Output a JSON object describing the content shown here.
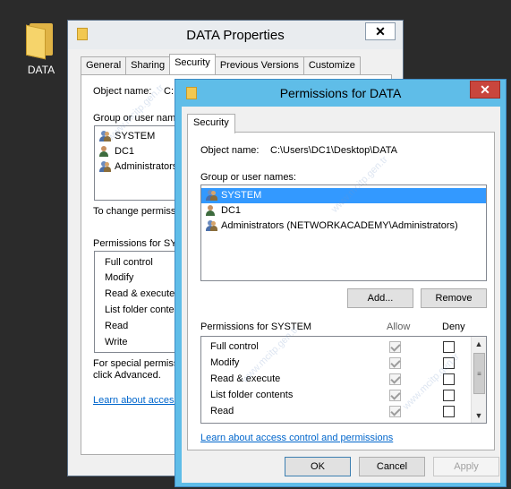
{
  "desktop": {
    "folder_label": "DATA"
  },
  "props": {
    "title": "DATA Properties",
    "close_glyph": "✕",
    "tabs": [
      "General",
      "Sharing",
      "Security",
      "Previous Versions",
      "Customize"
    ],
    "object_name_label": "Object name:",
    "object_name_value": "C:",
    "group_label": "Group or user name",
    "users": [
      "SYSTEM",
      "DC1",
      "Administrators"
    ],
    "change_perm_text": "To change permissi",
    "perm_for": "Permissions for SYS",
    "perms": [
      "Full control",
      "Modify",
      "Read & execute",
      "List folder conten",
      "Read",
      "Write"
    ],
    "special_text_1": "For special permissi",
    "special_text_2": "click Advanced.",
    "learn_link": "Learn about access"
  },
  "perm": {
    "title": "Permissions for DATA",
    "close_glyph": "✕",
    "tab": "Security",
    "object_name_label": "Object name:",
    "object_name_value": "C:\\Users\\DC1\\Desktop\\DATA",
    "group_label": "Group or user names:",
    "users": [
      "SYSTEM",
      "DC1",
      "Administrators (NETWORKACADEMY\\Administrators)"
    ],
    "add_button": "Add...",
    "remove_button": "Remove",
    "perm_for": "Permissions for SYSTEM",
    "allow_header": "Allow",
    "deny_header": "Deny",
    "perms": [
      "Full control",
      "Modify",
      "Read & execute",
      "List folder contents",
      "Read"
    ],
    "learn_link": "Learn about access control and permissions",
    "ok": "OK",
    "cancel": "Cancel",
    "apply": "Apply"
  },
  "watermark": "www.mcitp.gen.tr",
  "colors": {
    "accent": "#5fbde8",
    "selection": "#3399ff",
    "close_red": "#c9463d"
  }
}
